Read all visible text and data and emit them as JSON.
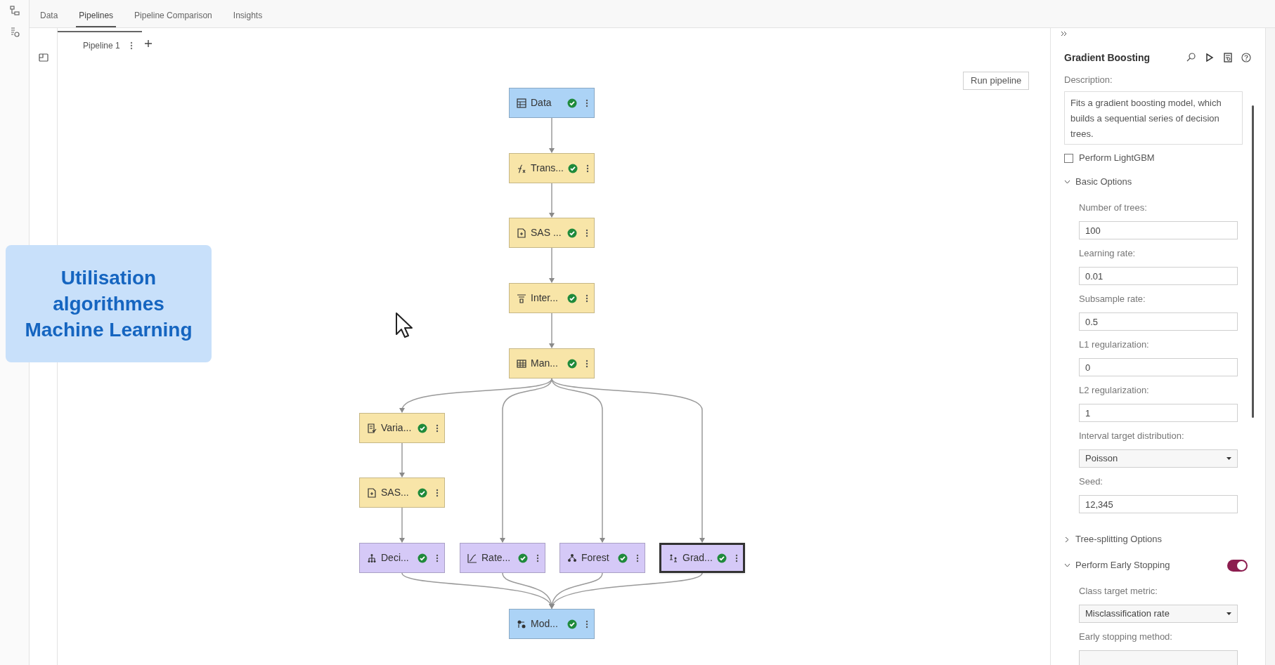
{
  "tabs": [
    {
      "label": "Data",
      "selected": false
    },
    {
      "label": "Pipelines",
      "selected": true
    },
    {
      "label": "Pipeline Comparison",
      "selected": false
    },
    {
      "label": "Insights",
      "selected": false
    }
  ],
  "pipeline_tabs": [
    {
      "label": "Pipeline 1",
      "selected": true
    }
  ],
  "run_button": "Run pipeline",
  "banner": {
    "lines": [
      "Utilisation",
      "algorithmes",
      "Machine Learning"
    ]
  },
  "nodes": [
    {
      "label": "Data",
      "kind": "data",
      "color": "#acd3f6",
      "completed": true,
      "selected": false
    },
    {
      "label": "Trans...",
      "kind": "transform",
      "color": "#f8e5a8",
      "completed": true,
      "selected": false
    },
    {
      "label": "SAS ...",
      "kind": "code",
      "color": "#f8e5a8",
      "completed": true,
      "selected": false
    },
    {
      "label": "Inter...",
      "kind": "filter",
      "color": "#f8e5a8",
      "completed": true,
      "selected": false
    },
    {
      "label": "Man...",
      "kind": "table",
      "color": "#f8e5a8",
      "completed": true,
      "selected": false
    },
    {
      "label": "Varia...",
      "kind": "variable",
      "color": "#f8e5a8",
      "completed": true,
      "selected": false
    },
    {
      "label": "SAS...",
      "kind": "code",
      "color": "#f8e5a8",
      "completed": true,
      "selected": false
    },
    {
      "label": "Deci...",
      "kind": "tree",
      "color": "#d5c9f7",
      "completed": true,
      "selected": false
    },
    {
      "label": "Rate...",
      "kind": "chart",
      "color": "#d5c9f7",
      "completed": true,
      "selected": false
    },
    {
      "label": "Forest",
      "kind": "forest",
      "color": "#d5c9f7",
      "completed": true,
      "selected": false
    },
    {
      "label": "Grad...",
      "kind": "boost",
      "color": "#d5c9f7",
      "completed": true,
      "selected": true
    },
    {
      "label": "Mod...",
      "kind": "compare",
      "color": "#acd3f6",
      "completed": true,
      "selected": false
    }
  ],
  "panel": {
    "title": "Gradient Boosting",
    "description_label": "Description:",
    "description": "Fits a gradient boosting model, which builds a sequential series of decision trees.",
    "items": [
      {
        "kind": "checkbox",
        "label": "Perform LightGBM",
        "checked": false
      },
      {
        "kind": "section",
        "label": "Basic Options",
        "expanded": true,
        "children": [
          {
            "kind": "input",
            "label": "Number of trees:",
            "value": "100"
          },
          {
            "kind": "input",
            "label": "Learning rate:",
            "value": "0.01"
          },
          {
            "kind": "input",
            "label": "Subsample rate:",
            "value": "0.5"
          },
          {
            "kind": "input",
            "label": "L1 regularization:",
            "value": "0"
          },
          {
            "kind": "input",
            "label": "L2 regularization:",
            "value": "1"
          },
          {
            "kind": "select",
            "label": "Interval target distribution:",
            "value": "Poisson"
          },
          {
            "kind": "input",
            "label": "Seed:",
            "value": "12,345"
          }
        ]
      },
      {
        "kind": "section",
        "label": "Tree-splitting Options",
        "expanded": false
      },
      {
        "kind": "toggle_section",
        "label": "Perform Early Stopping",
        "expanded": true,
        "on": true,
        "children": [
          {
            "kind": "select",
            "label": "Class target metric:",
            "value": "Misclassification rate"
          },
          {
            "kind": "select",
            "label": "Early stopping method:"
          }
        ]
      }
    ]
  }
}
